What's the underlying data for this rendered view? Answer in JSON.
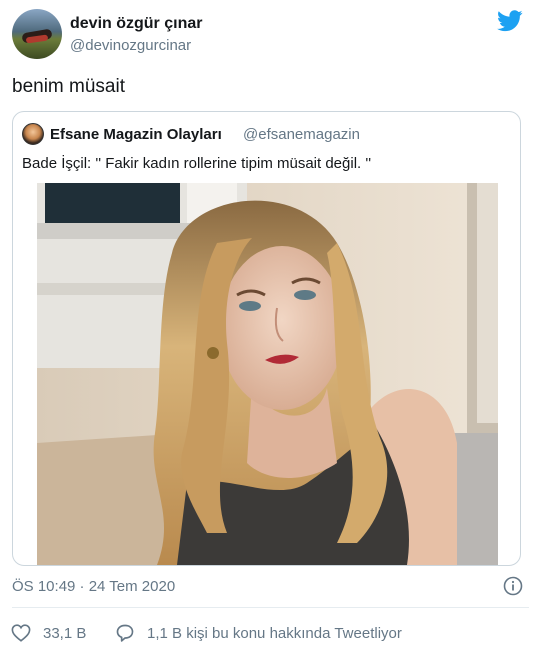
{
  "author": {
    "display_name": "devin özgür çınar",
    "handle": "@devinozgurcinar"
  },
  "tweet": {
    "text": "benim müsait"
  },
  "quoted_tweet": {
    "display_name": "Efsane Magazin Olayları",
    "handle": "@efsanemagazin",
    "text": "Bade İşçil: '' Fakir kadın rollerine tipim müsait değil. ''"
  },
  "meta": {
    "timestamp": "ÖS 10:49 · 24 Tem 2020"
  },
  "actions": {
    "likes": "33,1 B",
    "talking": "1,1 B kişi bu konu hakkında Tweetliyor"
  },
  "colors": {
    "twitter_blue": "#1da1f2",
    "secondary_text": "#657786",
    "border": "#ccd6dd"
  },
  "icons": [
    "twitter-bird-icon",
    "info-icon",
    "heart-icon",
    "reply-bubble-icon"
  ]
}
